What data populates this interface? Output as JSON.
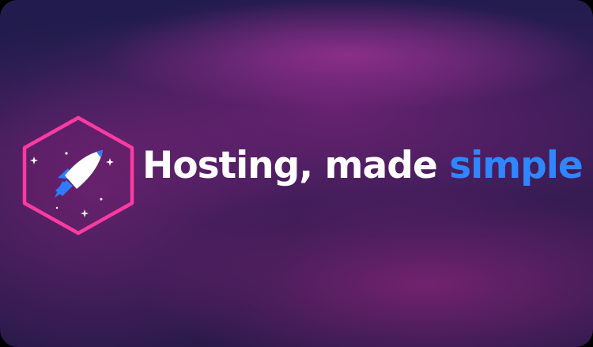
{
  "brand": {
    "logo_icon": "rocket-hexagon-icon",
    "tagline_main": "Hosting, made",
    "tagline_accent": "simple"
  },
  "colors": {
    "hexagon_border": "#ff3aa0",
    "accent_text": "#2f86ff",
    "main_text": "#ffffff",
    "rocket_body": "#ffffff",
    "rocket_fins": "#2f7bff"
  }
}
